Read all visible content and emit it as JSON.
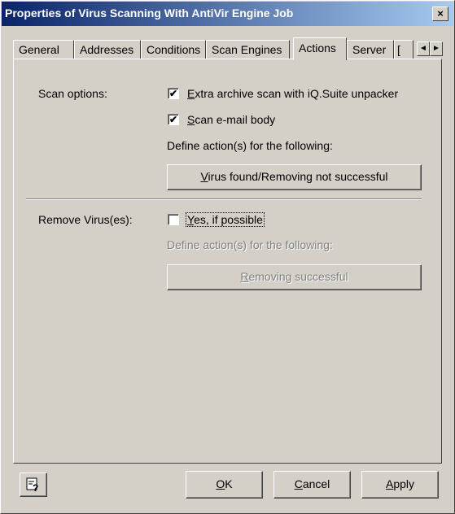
{
  "window": {
    "title": "Properties of Virus Scanning With AntiVir Engine Job",
    "close_glyph": "×"
  },
  "tabs": [
    {
      "label": "General"
    },
    {
      "label": "Addresses"
    },
    {
      "label": "Conditions"
    },
    {
      "label": "Scan Engines"
    },
    {
      "label": "Actions",
      "active": true
    },
    {
      "label": "Server"
    },
    {
      "label": "["
    }
  ],
  "tab_scroll": {
    "left": "◄",
    "right": "►"
  },
  "scan_options": {
    "label": "Scan options:",
    "extra_archive": {
      "label_first": "E",
      "label_rest": "xtra archive scan with iQ.Suite unpacker",
      "checked": true
    },
    "scan_body": {
      "label_first": "S",
      "label_rest": "can e-mail body",
      "checked": true
    },
    "define_text": "Define action(s) for the following:",
    "button": {
      "label_first": "V",
      "label_rest": "irus found/Removing not successful"
    }
  },
  "remove_virus": {
    "label": "Remove Virus(es):",
    "yes_possible": {
      "label_first": "Y",
      "label_rest": "es, if possible",
      "checked": false
    },
    "define_text": "Define action(s) for the following:",
    "button": {
      "label_first": "R",
      "label_rest": "emoving successful",
      "enabled": false
    }
  },
  "footer": {
    "help_icon": "help-icon",
    "ok": {
      "label_first": "O",
      "label_rest": "K"
    },
    "cancel": {
      "label_first": "C",
      "label_rest": "ancel"
    },
    "apply": {
      "label_first": "A",
      "label_rest": "pply"
    }
  },
  "check_glyph": "✔"
}
